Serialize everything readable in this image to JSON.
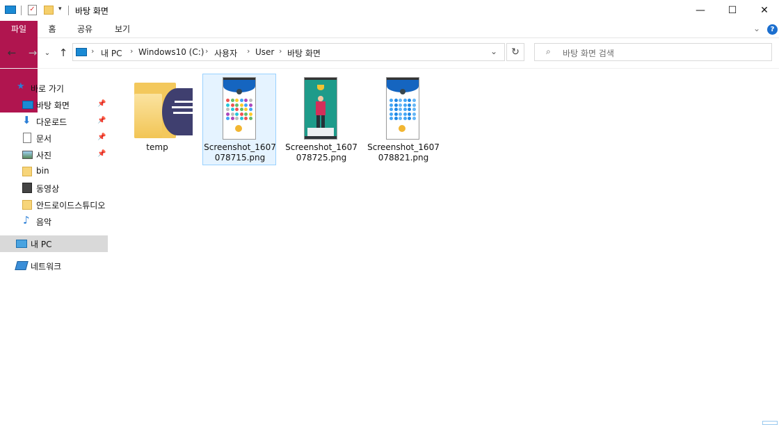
{
  "window": {
    "title": "바탕 화면",
    "minimize": "—",
    "maximize": "☐",
    "close": "✕"
  },
  "ribbon": {
    "tabs": [
      "파일",
      "홈",
      "공유",
      "보기"
    ]
  },
  "address": {
    "crumbs": [
      "내 PC",
      "Windows10 (C:)",
      "사용자",
      "User",
      "바탕 화면"
    ],
    "search_placeholder": "바탕 화면 검색"
  },
  "nav": {
    "quick_access": "바로 가기",
    "items": [
      {
        "label": "바탕 화면",
        "pinned": true
      },
      {
        "label": "다운로드",
        "pinned": true
      },
      {
        "label": "문서",
        "pinned": true
      },
      {
        "label": "사진",
        "pinned": true
      },
      {
        "label": "bin",
        "pinned": false
      },
      {
        "label": "동영상",
        "pinned": false
      },
      {
        "label": "안드로이드스튜디오",
        "pinned": false
      },
      {
        "label": "음악",
        "pinned": false
      }
    ],
    "this_pc": "내 PC",
    "network": "네트워크"
  },
  "files": [
    {
      "name": "temp",
      "type": "folder"
    },
    {
      "name": "Screenshot_1607078715.png",
      "type": "image",
      "selected": true
    },
    {
      "name": "Screenshot_1607078725.png",
      "type": "image"
    },
    {
      "name": "Screenshot_1607078821.png",
      "type": "image"
    }
  ],
  "colors": {
    "accent": "#b0154f",
    "selection": "#e5f3ff",
    "selection_border": "#99d1ff",
    "nav_selected": "#d9d9d9"
  }
}
